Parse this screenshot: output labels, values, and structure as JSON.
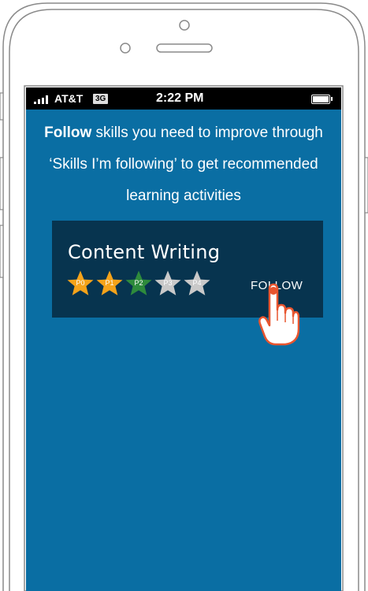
{
  "status_bar": {
    "carrier": "AT&T",
    "network": "3G",
    "time": "2:22 PM"
  },
  "intro": {
    "bold": "Follow",
    "rest": " skills you need to improve through ‘Skills I’m following’ to get recommended learning activities"
  },
  "card": {
    "title": "Content Writing",
    "stars": [
      {
        "label": "P0",
        "color": "#f5a31a"
      },
      {
        "label": "P1",
        "color": "#f5a31a"
      },
      {
        "label": "P2",
        "color": "#2e8b3c"
      },
      {
        "label": "P3",
        "color": "#c9c9c9"
      },
      {
        "label": "P4",
        "color": "#c9c9c9"
      }
    ],
    "follow_label": "FOLLOW"
  },
  "colors": {
    "screen_bg": "#0a6ea3",
    "card_bg": "#07344f",
    "hand_outline": "#e8552f"
  }
}
